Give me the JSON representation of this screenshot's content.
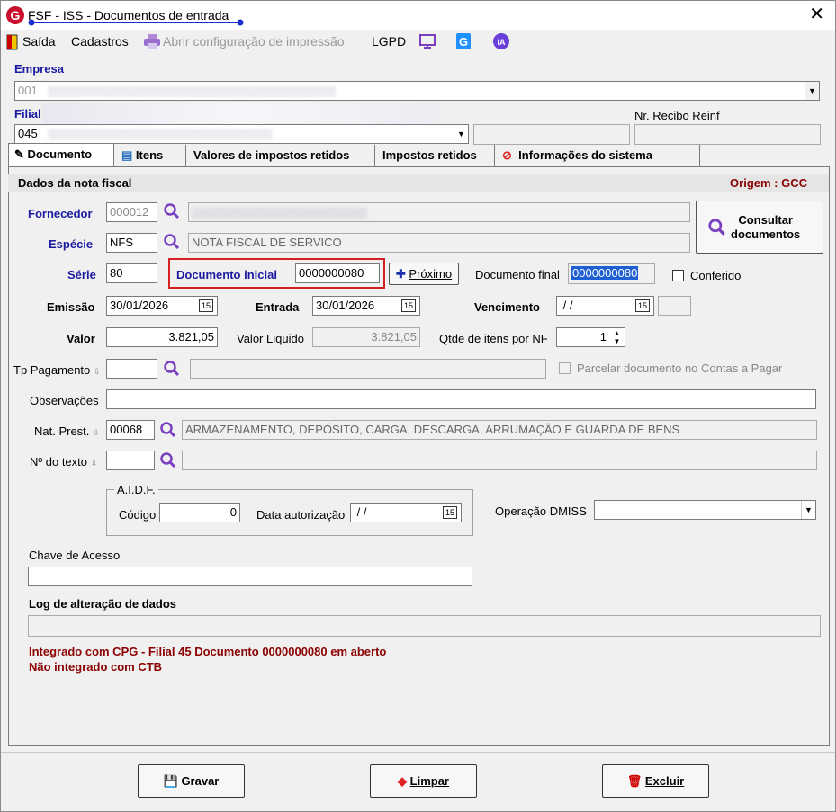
{
  "window": {
    "title": "FSF - ISS - Documentos de entrada",
    "app_icon": "G"
  },
  "menu": {
    "saida": "Saída",
    "cadastros": "Cadastros",
    "abrir_config": "Abrir configuração de impressão",
    "lgpd": "LGPD"
  },
  "empresa": {
    "label": "Empresa",
    "value": "001"
  },
  "filial": {
    "label": "Filial",
    "value": "045",
    "recibo_label": "Nr. Recibo Reinf"
  },
  "tabs": [
    "Documento",
    "Itens",
    "Valores de impostos retidos",
    "Impostos retidos",
    "Informações do sistema"
  ],
  "section": {
    "title": "Dados da nota fiscal",
    "origem": "Origem : GCC"
  },
  "fornecedor": {
    "label": "Fornecedor",
    "value": "000012"
  },
  "especie": {
    "label": "Espécie",
    "value": "NFS",
    "desc": "NOTA FISCAL DE SERVICO"
  },
  "consultar": {
    "label1": "Consultar",
    "label2": "documentos"
  },
  "serie": {
    "label": "Série",
    "value": "80"
  },
  "documento_inicial": {
    "label": "Documento inicial",
    "value": "0000000080"
  },
  "proximo": {
    "label": "Próximo"
  },
  "documento_final": {
    "label": "Documento final",
    "value": "0000000080"
  },
  "conferido": {
    "label": "Conferido"
  },
  "emissao": {
    "label": "Emissão",
    "value": "30/01/2026"
  },
  "entrada": {
    "label": "Entrada",
    "value": "30/01/2026"
  },
  "vencimento": {
    "label": "Vencimento",
    "value": " / /"
  },
  "valor": {
    "label": "Valor",
    "value": "3.821,05"
  },
  "valor_liquido": {
    "label": "Valor Liquido",
    "value": "3.821,05"
  },
  "qtde_itens": {
    "label": "Qtde de itens por NF",
    "value": "1"
  },
  "tp_pagamento": {
    "label": "Tp Pagamento"
  },
  "parcelar": {
    "label": "Parcelar documento no Contas a Pagar"
  },
  "observacoes": {
    "label": "Observações"
  },
  "nat_prest": {
    "label": "Nat. Prest.",
    "value": "00068",
    "desc": "ARMAZENAMENTO, DEPÓSITO, CARGA, DESCARGA, ARRUMAÇÃO E GUARDA DE BENS"
  },
  "num_texto": {
    "label": "Nº do texto"
  },
  "aidf": {
    "title": "A.I.D.F.",
    "codigo_label": "Código",
    "codigo_value": "0",
    "data_label": "Data autorização",
    "data_value": " / /"
  },
  "operacao_dmiss": {
    "label": "Operação DMISS"
  },
  "chave_acesso": {
    "label": "Chave de Acesso"
  },
  "log": {
    "label": "Log de alteração de dados"
  },
  "status": {
    "line1": "Integrado com CPG - Filial 45 Documento 0000000080 em aberto",
    "line2": "Não integrado com CTB"
  },
  "buttons": {
    "gravar": "Gravar",
    "limpar": "Limpar",
    "excluir": "Excluir"
  },
  "colors": {
    "accent_purple": "#7a3fc0",
    "status_red": "#8b0000",
    "highlight_blue": "#1e5fd6"
  }
}
